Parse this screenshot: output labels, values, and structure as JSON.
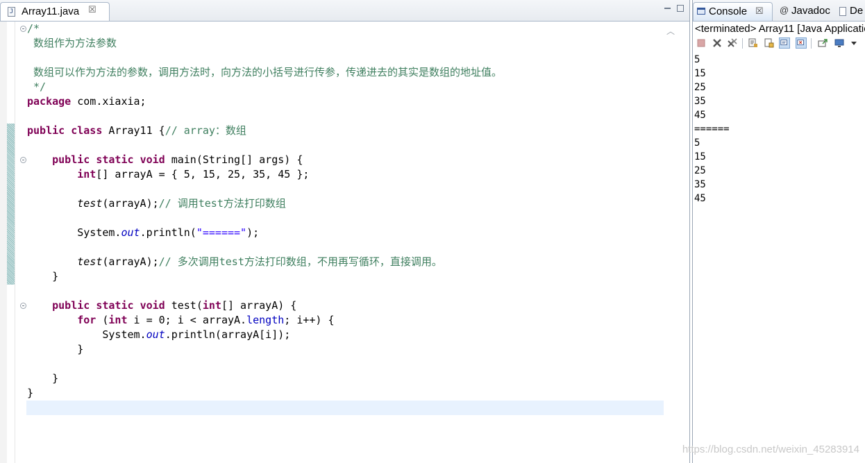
{
  "editor": {
    "tab_title": "Array11.java",
    "tab_close": "☒",
    "code_lines": [
      [
        {
          "t": "/*",
          "c": "cm"
        }
      ],
      [
        {
          "t": " 数组作为方法参数",
          "c": "cm"
        }
      ],
      [],
      [
        {
          "t": " 数组可以作为方法的参数，调用方法时，向方法的小括号进行传参，传递进去的其实是数组的地址值。",
          "c": "cm"
        }
      ],
      [
        {
          "t": " */",
          "c": "cm"
        }
      ],
      [
        {
          "t": "package",
          "c": "kw"
        },
        {
          "t": " com.xiaxia;"
        }
      ],
      [],
      [
        {
          "t": "public",
          "c": "kw"
        },
        {
          "t": " "
        },
        {
          "t": "class",
          "c": "kw"
        },
        {
          "t": " Array11 {"
        },
        {
          "t": "// array：数组",
          "c": "cm"
        }
      ],
      [],
      [
        {
          "t": "    "
        },
        {
          "t": "public",
          "c": "kw"
        },
        {
          "t": " "
        },
        {
          "t": "static",
          "c": "kw"
        },
        {
          "t": " "
        },
        {
          "t": "void",
          "c": "kw"
        },
        {
          "t": " main(String[] args) {"
        }
      ],
      [
        {
          "t": "        "
        },
        {
          "t": "int",
          "c": "kw"
        },
        {
          "t": "[] arrayA = { 5, 15, 25, 35, 45 };"
        }
      ],
      [],
      [
        {
          "t": "        "
        },
        {
          "t": "test",
          "c": "it"
        },
        {
          "t": "(arrayA);"
        },
        {
          "t": "// 调用test方法打印数组",
          "c": "cm"
        }
      ],
      [],
      [
        {
          "t": "        System."
        },
        {
          "t": "out",
          "c": "fld"
        },
        {
          "t": ".println("
        },
        {
          "t": "\"======\"",
          "c": "st"
        },
        {
          "t": ");"
        }
      ],
      [],
      [
        {
          "t": "        "
        },
        {
          "t": "test",
          "c": "it"
        },
        {
          "t": "(arrayA);"
        },
        {
          "t": "// 多次调用test方法打印数组，不用再写循环，直接调用。",
          "c": "cm"
        }
      ],
      [
        {
          "t": "    }"
        }
      ],
      [],
      [
        {
          "t": "    "
        },
        {
          "t": "public",
          "c": "kw"
        },
        {
          "t": " "
        },
        {
          "t": "static",
          "c": "kw"
        },
        {
          "t": " "
        },
        {
          "t": "void",
          "c": "kw"
        },
        {
          "t": " test("
        },
        {
          "t": "int",
          "c": "kw"
        },
        {
          "t": "[] arrayA) {"
        }
      ],
      [
        {
          "t": "        "
        },
        {
          "t": "for",
          "c": "kw"
        },
        {
          "t": " ("
        },
        {
          "t": "int",
          "c": "kw"
        },
        {
          "t": " i = 0; i < arrayA."
        },
        {
          "t": "length",
          "c": "fld2"
        },
        {
          "t": "; i++) {"
        }
      ],
      [
        {
          "t": "            System."
        },
        {
          "t": "out",
          "c": "fld"
        },
        {
          "t": ".println(arrayA[i]);"
        }
      ],
      [
        {
          "t": "        }"
        }
      ],
      [],
      [
        {
          "t": "    }"
        }
      ],
      [
        {
          "t": "}"
        }
      ]
    ]
  },
  "console": {
    "tabs": [
      {
        "label": "Console",
        "close": "☒"
      },
      {
        "label": "Javadoc",
        "icon_text": "@"
      },
      {
        "label": "De"
      }
    ],
    "status": "<terminated> Array11 [Java Application]",
    "output": [
      "5",
      "15",
      "25",
      "35",
      "45",
      "======",
      "5",
      "15",
      "25",
      "35",
      "45"
    ]
  },
  "watermark": "https://blog.csdn.net/weixin_45283914",
  "icons": [
    "java-file-icon",
    "console-icon",
    "javadoc-icon",
    "declaration-icon",
    "terminate-icon",
    "remove-launch-icon",
    "remove-all-icon",
    "clear-console-icon",
    "scroll-lock-icon",
    "word-wrap-icon",
    "show-on-stdout-icon",
    "show-on-stderr-icon",
    "pin-console-icon",
    "display-console-icon",
    "view-menu-icon"
  ],
  "colors": {
    "keyword": "#7f0055",
    "comment": "#3f7f5f",
    "string": "#2a00ff",
    "field": "#0000c0",
    "current_line": "#e8f2fe"
  }
}
